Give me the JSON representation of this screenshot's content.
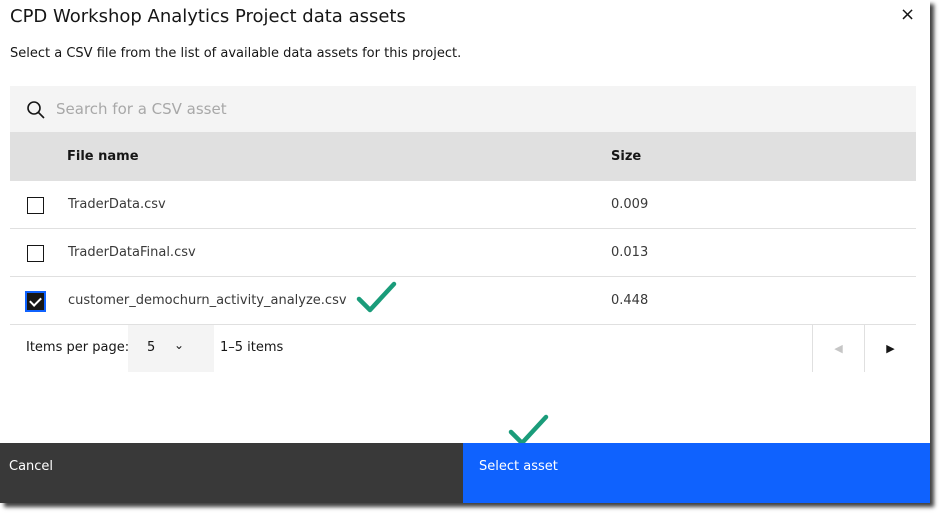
{
  "title": "CPD Workshop Analytics Project data assets",
  "close_icon": "×",
  "subtitle": "Select a CSV file from the list of available data assets for this project.",
  "search": {
    "placeholder": "Search for a CSV asset",
    "value": ""
  },
  "table": {
    "headers": [
      "File name",
      "Size"
    ],
    "rows": [
      {
        "name": "TraderData.csv",
        "size": "0.009",
        "checked": false
      },
      {
        "name": "TraderDataFinal.csv",
        "size": "0.013",
        "checked": false
      },
      {
        "name": "customer_demochurn_activity_analyze.csv",
        "size": "0.448",
        "checked": true
      }
    ]
  },
  "pagination": {
    "items_per_page_label": "Items per page:",
    "items_per_page": "5",
    "range": "1–5 items",
    "prev_icon": "◀",
    "next_icon": "▶"
  },
  "footer": {
    "cancel": "Cancel",
    "select": "Select asset"
  },
  "colors": {
    "primary": "#0f62fe",
    "secondary": "#393939",
    "annotation": "#1a9c7a"
  }
}
